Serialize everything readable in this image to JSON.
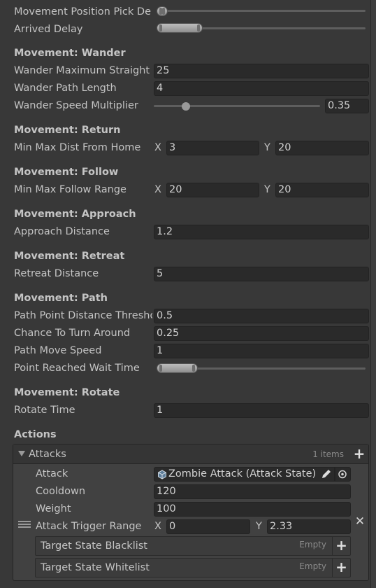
{
  "fields": {
    "movement_position_pick_delay": {
      "label": "Movement Position Pick De"
    },
    "arrived_delay": {
      "label": "Arrived Delay"
    }
  },
  "wander": {
    "header": "Movement: Wander",
    "max_straight": {
      "label": "Wander Maximum Straight P",
      "value": "25"
    },
    "path_length": {
      "label": "Wander Path Length",
      "value": "4"
    },
    "speed_multiplier": {
      "label": "Wander Speed Multiplier",
      "value": "0.35",
      "slider_fraction": 0.15
    }
  },
  "return": {
    "header": "Movement: Return",
    "min_max_dist": {
      "label": "Min Max Dist From Home",
      "x_label": "X",
      "x": "3",
      "y_label": "Y",
      "y": "20"
    }
  },
  "follow": {
    "header": "Movement: Follow",
    "min_max_range": {
      "label": "Min Max Follow Range",
      "x_label": "X",
      "x": "20",
      "y_label": "Y",
      "y": "20"
    }
  },
  "approach": {
    "header": "Movement: Approach",
    "distance": {
      "label": "Approach Distance",
      "value": "1.2"
    }
  },
  "retreat": {
    "header": "Movement: Retreat",
    "distance": {
      "label": "Retreat Distance",
      "value": "5"
    }
  },
  "path": {
    "header": "Movement: Path",
    "point_distance_threshold": {
      "label": "Path Point Distance Thresho",
      "value": "0.5"
    },
    "chance_to_turn": {
      "label": "Chance To Turn Around",
      "value": "0.25"
    },
    "move_speed": {
      "label": "Path Move Speed",
      "value": "1"
    },
    "point_reached_wait": {
      "label": "Point Reached Wait Time"
    }
  },
  "rotate": {
    "header": "Movement: Rotate",
    "rotate_time": {
      "label": "Rotate Time",
      "value": "1"
    }
  },
  "actions": {
    "header": "Actions",
    "attacks": {
      "title": "Attacks",
      "count": "1 items",
      "element": {
        "attack": {
          "label": "Attack",
          "value": "Zombie Attack (Attack State)"
        },
        "cooldown": {
          "label": "Cooldown",
          "value": "120"
        },
        "weight": {
          "label": "Weight",
          "value": "100"
        },
        "trigger_range": {
          "label": "Attack Trigger Range",
          "x_label": "X",
          "x": "0",
          "y_label": "Y",
          "y": "2.33"
        },
        "blacklist": {
          "label": "Target State Blacklist",
          "empty": "Empty"
        },
        "whitelist": {
          "label": "Target State Whitelist",
          "empty": "Empty"
        }
      }
    }
  }
}
